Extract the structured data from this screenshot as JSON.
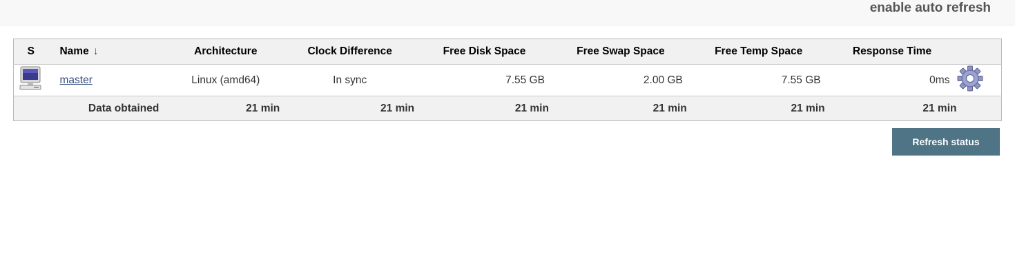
{
  "header": {
    "auto_refresh_label": "enable auto refresh"
  },
  "table": {
    "columns": [
      "S",
      "Name",
      "Architecture",
      "Clock Difference",
      "Free Disk Space",
      "Free Swap Space",
      "Free Temp Space",
      "Response Time"
    ],
    "sort_indicator": "↓",
    "rows": [
      {
        "status_icon": "computer-icon",
        "name": "master",
        "architecture": "Linux (amd64)",
        "clock_difference": "In sync",
        "free_disk_space": "7.55 GB",
        "free_swap_space": "2.00 GB",
        "free_temp_space": "7.55 GB",
        "response_time": "0ms",
        "action_icon": "gear-icon"
      }
    ],
    "footer": {
      "label": "Data obtained",
      "architecture": "21 min",
      "clock_difference": "21 min",
      "free_disk_space": "21 min",
      "free_swap_space": "21 min",
      "free_temp_space": "21 min",
      "response_time": "21 min"
    }
  },
  "refresh_button_label": "Refresh status",
  "colors": {
    "button_bg": "#4e7485",
    "link": "#334c80",
    "header_bg": "#f1f1f1"
  }
}
